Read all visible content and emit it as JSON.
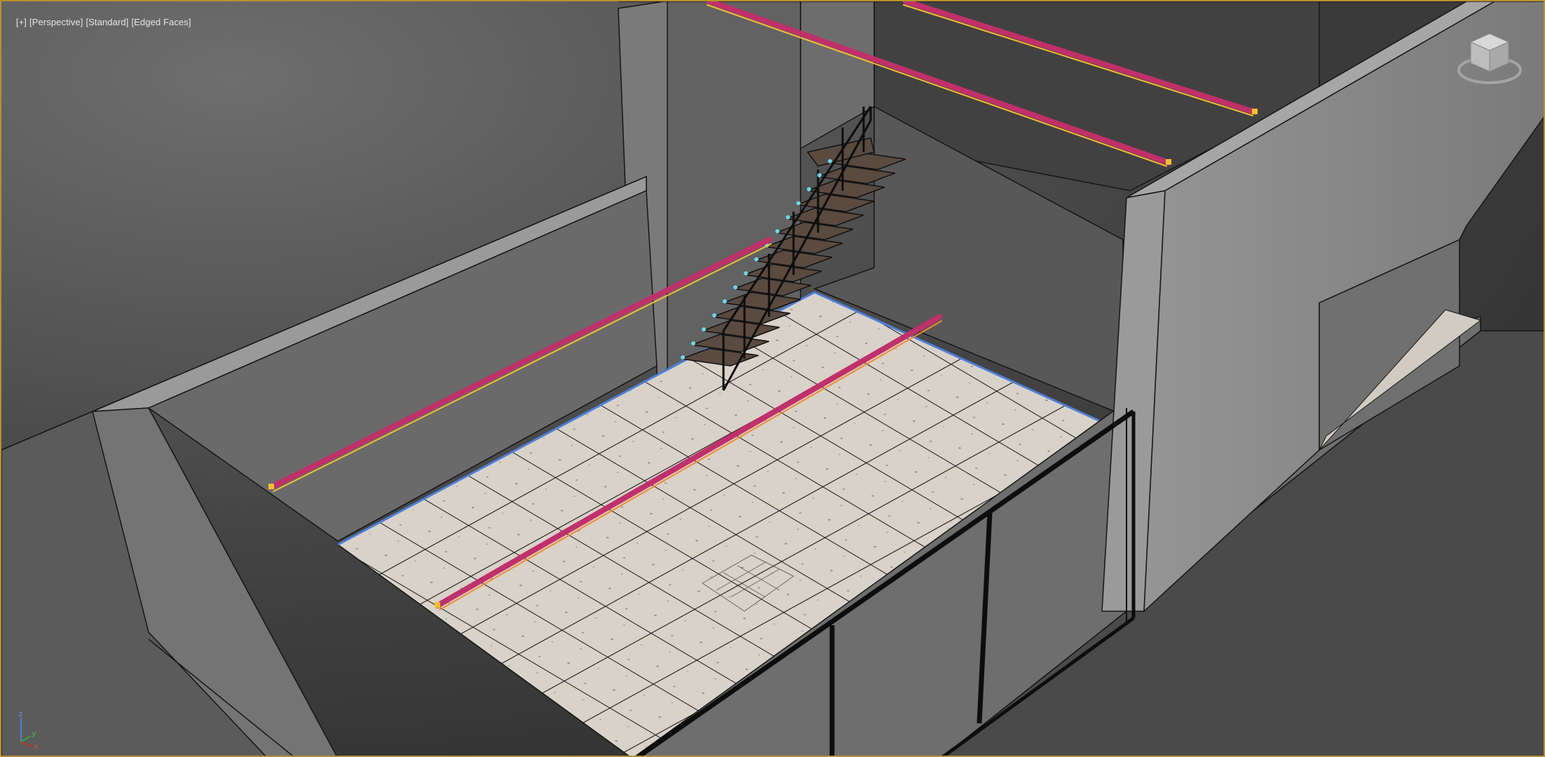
{
  "viewport": {
    "label_plus": "[+]",
    "label_view": "[Perspective]",
    "label_shading": "[Standard]",
    "label_mode": "[Edged Faces]",
    "border_color": "#b8902e",
    "background_top": "#6b6b6b",
    "background_bottom": "#2e2e2e"
  },
  "viewcube": {
    "icon": "viewcube-icon"
  },
  "axis_tripod": {
    "x": "x",
    "y": "y",
    "z": "z"
  },
  "colors": {
    "wall_light": "#8e8e8e",
    "wall_mid": "#727272",
    "wall_dark": "#5a5a5a",
    "floor_tile": "#d6cfc6",
    "tile_line": "#1a1a1a",
    "beam_yellow": "#f0c030",
    "beam_magenta": "#c0306a",
    "selection_blue": "#4f7fd8",
    "stair_tread": "#5a4a40"
  }
}
